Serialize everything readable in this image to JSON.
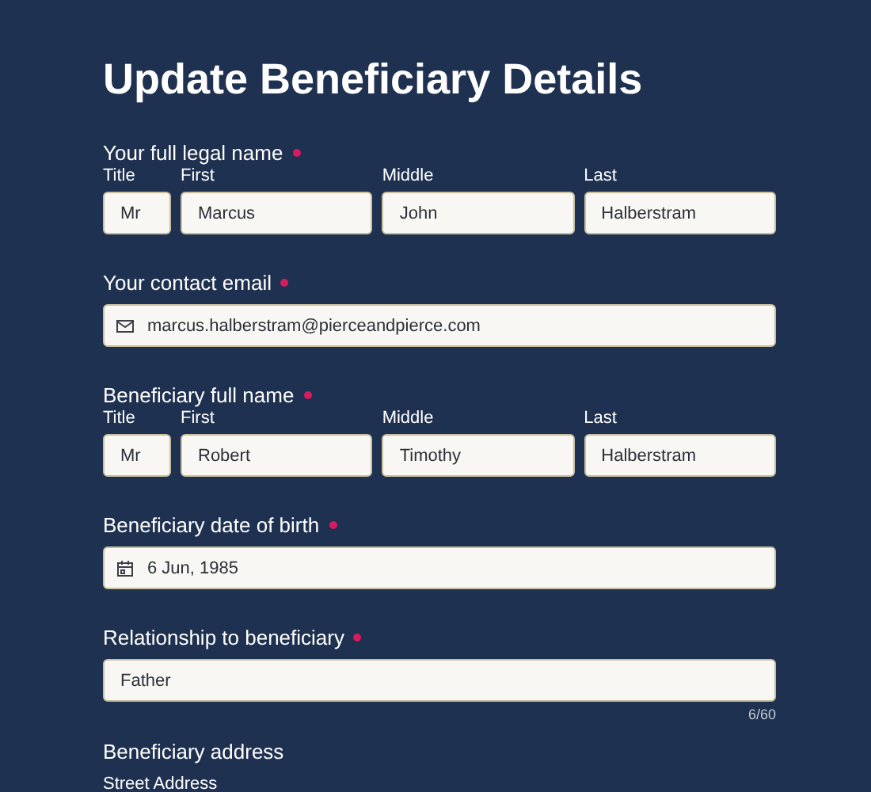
{
  "title": "Update Beneficiary Details",
  "sections": [
    {
      "kind": "name",
      "label": "Your full legal name",
      "required": true,
      "parts": [
        {
          "label": "Title",
          "value": "Mr"
        },
        {
          "label": "First",
          "value": "Marcus"
        },
        {
          "label": "Middle",
          "value": "John"
        },
        {
          "label": "Last",
          "value": "Halberstram"
        }
      ]
    },
    {
      "kind": "email",
      "label": "Your contact email",
      "required": true,
      "value": "marcus.halberstram@pierceandpierce.com"
    },
    {
      "kind": "name",
      "label": "Beneficiary full name",
      "required": true,
      "parts": [
        {
          "label": "Title",
          "value": "Mr"
        },
        {
          "label": "First",
          "value": "Robert"
        },
        {
          "label": "Middle",
          "value": "Timothy"
        },
        {
          "label": "Last",
          "value": "Halberstram"
        }
      ]
    },
    {
      "kind": "date",
      "label": "Beneficiary date of birth",
      "required": true,
      "value": "6 Jun, 1985"
    },
    {
      "kind": "text",
      "label": "Relationship to beneficiary",
      "required": true,
      "value": "Father",
      "counter": "6/60"
    },
    {
      "kind": "address",
      "label": "Beneficiary address",
      "required": false,
      "sublabel": "Street Address"
    }
  ]
}
